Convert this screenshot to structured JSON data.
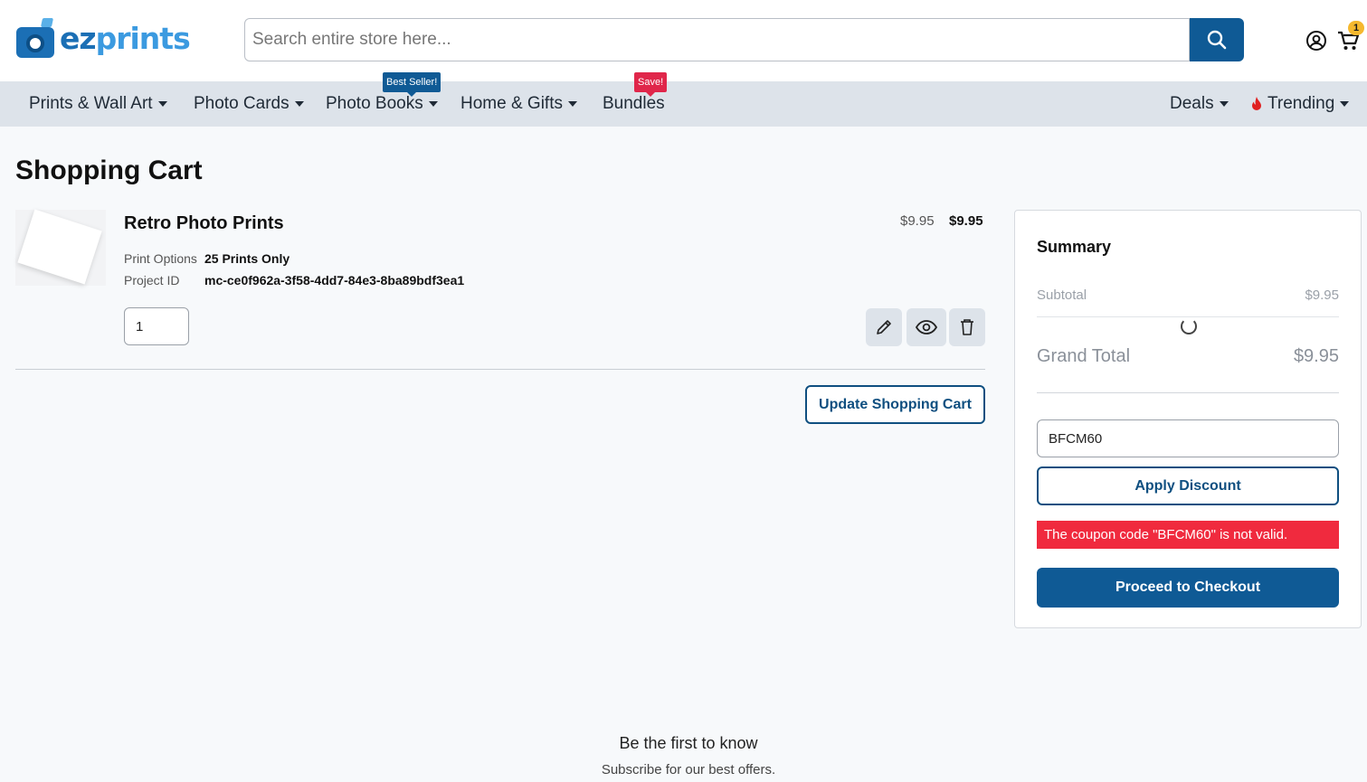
{
  "brand": {
    "logo_ez": "ez",
    "logo_prints": "prints",
    "accent": "#0f5a95",
    "error_color": "#f02a3e"
  },
  "header": {
    "search_placeholder": "Search entire store here...",
    "cart_count": "1"
  },
  "nav": {
    "items": [
      {
        "label": "Prints & Wall Art"
      },
      {
        "label": "Photo Cards"
      },
      {
        "label": "Photo Books",
        "tag": "Best Seller!"
      },
      {
        "label": "Home & Gifts"
      },
      {
        "label": "Bundles",
        "tag": "Save!"
      },
      {
        "label": "Deals"
      },
      {
        "label": "Trending"
      }
    ]
  },
  "cart": {
    "title": "Shopping Cart",
    "item": {
      "name": "Retro Photo Prints",
      "options": [
        {
          "label": "Print Options",
          "value": "25 Prints Only"
        },
        {
          "label": "Project ID",
          "value": "mc-ce0f962a-3f58-4dd7-84e3-8ba89bdf3ea1"
        }
      ],
      "unit_price": "$9.95",
      "row_total": "$9.95",
      "quantity": "1"
    },
    "update_label": "Update Shopping Cart"
  },
  "summary": {
    "title": "Summary",
    "subtotal_label": "Subtotal",
    "subtotal_value": "$9.95",
    "grand_total_label": "Grand Total",
    "grand_total_value": "$9.95",
    "coupon_value": "BFCM60",
    "apply_label": "Apply Discount",
    "error_message": "The coupon code \"BFCM60\" is not valid.",
    "checkout_label": "Proceed to Checkout"
  },
  "footer": {
    "newsletter_title": "Be the first to know",
    "newsletter_sub": "Subscribe for our best offers."
  }
}
